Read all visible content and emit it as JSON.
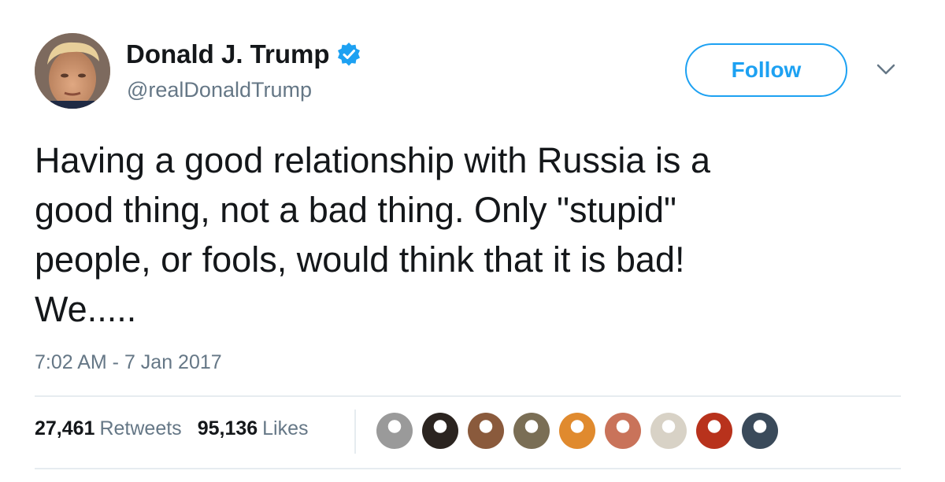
{
  "author": {
    "display_name": "Donald J. Trump",
    "handle": "@realDonaldTrump",
    "verified": true,
    "verified_icon": "verified-badge-icon"
  },
  "follow_button": {
    "label": "Follow"
  },
  "menu": {
    "icon": "chevron-down-icon"
  },
  "tweet": {
    "text_lines": [
      "Having a good relationship with Russia is a",
      "good thing, not a bad thing. Only \"stupid\"",
      "people, or fools, would think that it is bad!",
      "We....."
    ],
    "timestamp": "7:02 AM - 7 Jan 2017"
  },
  "stats": {
    "retweets_count": "27,461",
    "retweets_label": "Retweets",
    "likes_count": "95,136",
    "likes_label": "Likes"
  },
  "likers": [
    {
      "color": "#9a9a9a"
    },
    {
      "color": "#2b2420"
    },
    {
      "color": "#8a5a3c"
    },
    {
      "color": "#7a6e55"
    },
    {
      "color": "#e08a2e"
    },
    {
      "color": "#c9735a"
    },
    {
      "color": "#d8d2c6"
    },
    {
      "color": "#b8321c"
    },
    {
      "color": "#3a4a5a"
    }
  ],
  "colors": {
    "accent": "#1da1f2",
    "text": "#14171a",
    "muted": "#657786",
    "border": "#e6ecf0"
  }
}
